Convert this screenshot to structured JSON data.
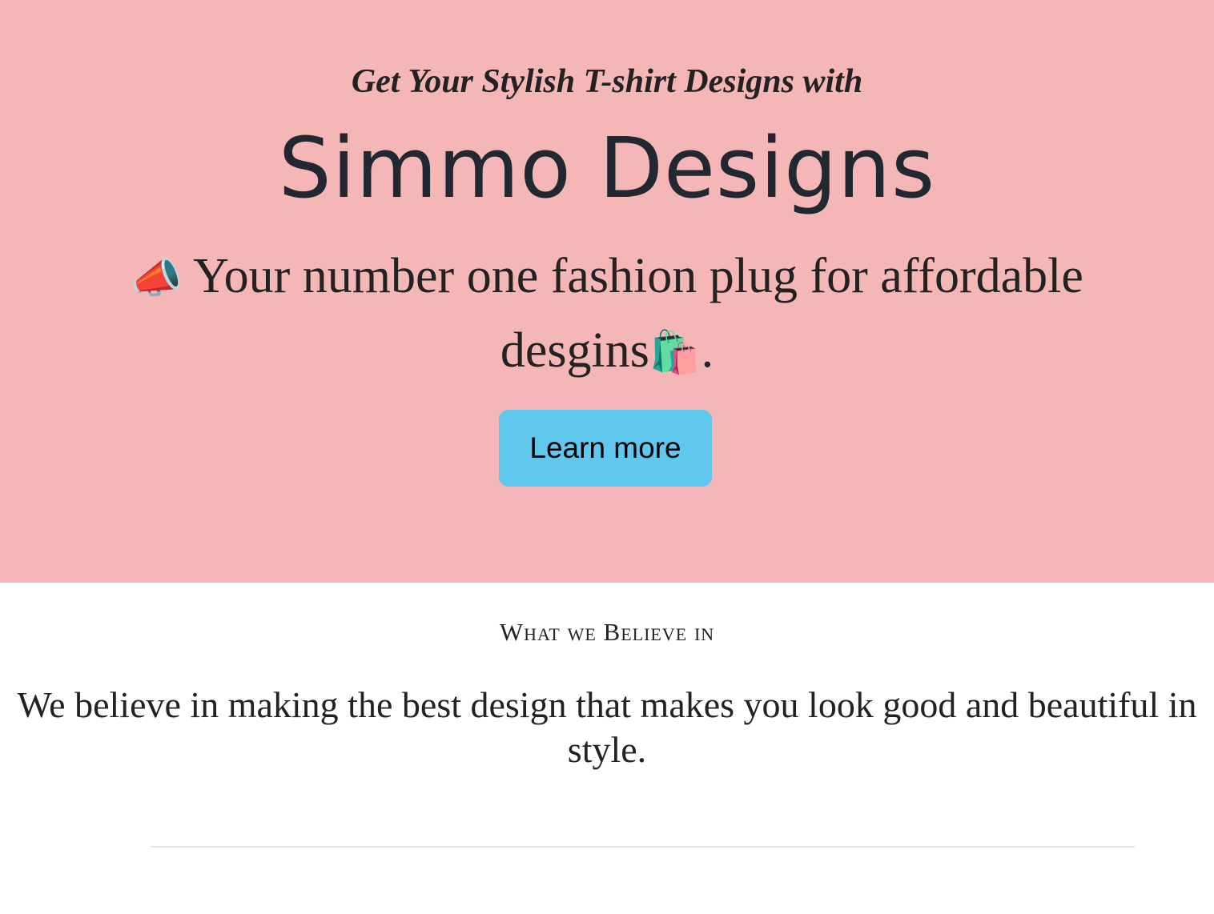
{
  "hero": {
    "kicker": "Get Your Stylish T-shirt Designs with",
    "brand": "Simmo Designs",
    "tagline_prefix": "📣",
    "tagline_text": " Your number one fashion plug for affordable desgins",
    "tagline_suffix_icon": "🛍️",
    "tagline_end": ".",
    "cta_label": "Learn more",
    "background_color": "#f4b6b6",
    "cta_color": "#5fc8ec"
  },
  "belief": {
    "title": "What we Believe in",
    "text": "We believe in making the best design that makes you look good and beautiful in style."
  },
  "icons": {
    "megaphone": "megaphone-icon",
    "shopping_bags": "shopping-bags-icon"
  }
}
